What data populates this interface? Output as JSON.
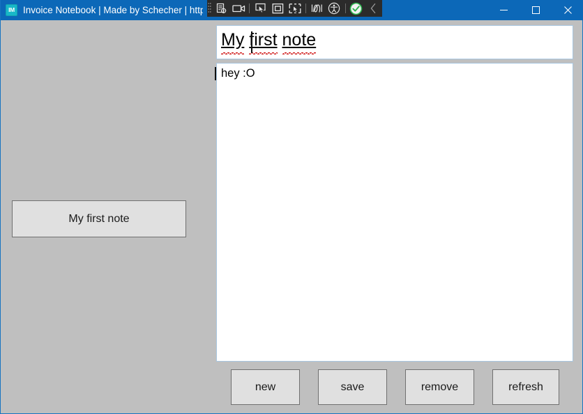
{
  "window": {
    "title": "Invoice Notebook | Made by Schecher | https://git",
    "app_icon_label": "IM",
    "titlebar_color": "#0c68b8",
    "background_color": "#bfbfbf",
    "controls": [
      {
        "name": "minimize",
        "glyph": "minimize-icon"
      },
      {
        "name": "maximize",
        "glyph": "maximize-icon"
      },
      {
        "name": "close",
        "glyph": "close-icon"
      }
    ]
  },
  "capture_toolbar": {
    "background_color": "#2b2b2b",
    "buttons": [
      {
        "name": "grip-handle",
        "icon": "drag-grip-icon"
      },
      {
        "name": "capture-settings",
        "icon": "document-gear-icon"
      },
      {
        "name": "record-video",
        "icon": "video-camera-icon"
      },
      {
        "name": "select-cursor",
        "icon": "cursor-arrow-icon"
      },
      {
        "name": "capture-region",
        "icon": "square-outline-icon"
      },
      {
        "name": "capture-window",
        "icon": "window-cursor-icon"
      },
      {
        "name": "highlight-scribble",
        "icon": "scribble-icon"
      },
      {
        "name": "accessibility",
        "icon": "accessibility-person-icon"
      },
      {
        "name": "confirm",
        "icon": "green-check-circle-icon"
      },
      {
        "name": "collapse-toolbar",
        "icon": "chevron-left-icon"
      }
    ],
    "accent_color": "#2bb24c"
  },
  "sidebar": {
    "notes": [
      {
        "label": "My first note"
      }
    ]
  },
  "editor": {
    "title_value": "My first note",
    "title_words": [
      "My",
      "first",
      "note"
    ],
    "body_value": "hey :O",
    "spellcheck_underline_color": "#d01919",
    "field_border_color": "#a8c6e0"
  },
  "actions": {
    "new_label": "new",
    "save_label": "save",
    "remove_label": "remove",
    "refresh_label": "refresh",
    "button_face_color": "#e0e0e0"
  }
}
